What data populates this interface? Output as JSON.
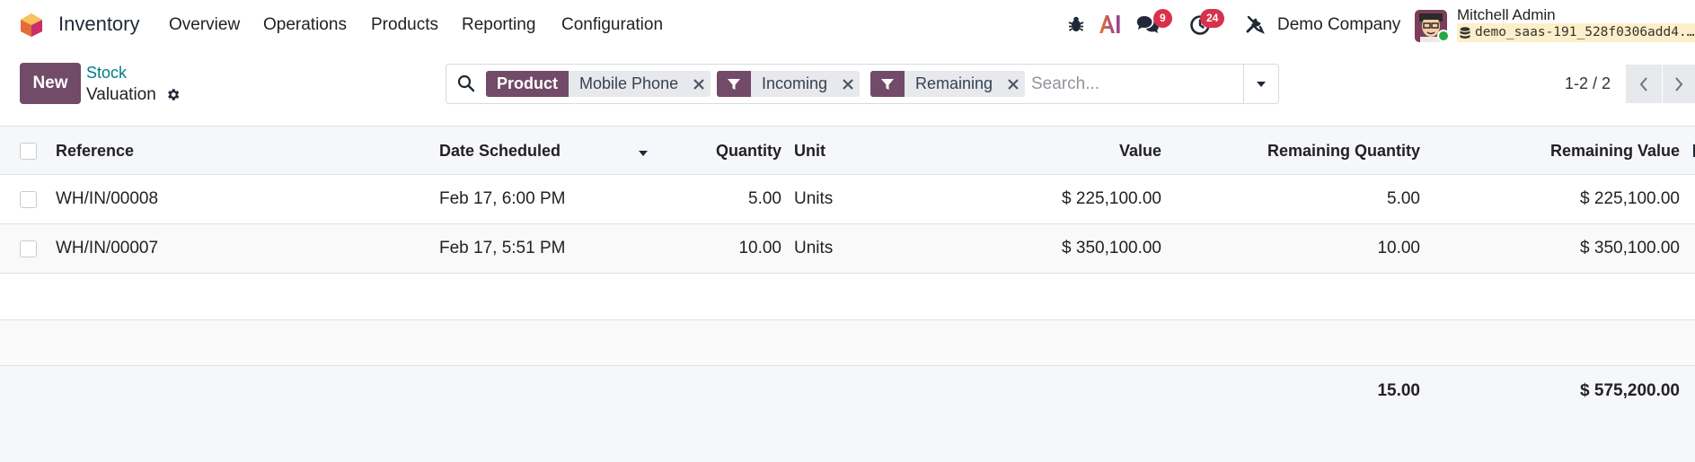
{
  "navbar": {
    "app_name": "Inventory",
    "menu": [
      "Overview",
      "Operations",
      "Products",
      "Reporting",
      "Configuration"
    ],
    "messages_badge": "9",
    "activities_badge": "24",
    "company": "Demo Company",
    "user_name": "Mitchell Admin",
    "database": "demo_saas-191_528f0306add4..."
  },
  "control": {
    "new_label": "New",
    "breadcrumb_parent": "Stock",
    "breadcrumb_current": "Valuation",
    "pager": "1-2 / 2"
  },
  "search": {
    "placeholder": "Search...",
    "facets": [
      {
        "type": "group",
        "label": "Product",
        "value": "Mobile Phone"
      },
      {
        "type": "filter",
        "value": "Incoming"
      },
      {
        "type": "filter",
        "value": "Remaining"
      }
    ]
  },
  "table": {
    "columns": [
      "Reference",
      "Date Scheduled",
      "Quantity",
      "Unit",
      "Value",
      "Remaining Quantity",
      "Remaining Value"
    ],
    "rows": [
      {
        "reference": "WH/IN/00008",
        "date": "Feb 17, 6:00 PM",
        "quantity": "5.00",
        "unit": "Units",
        "value": "$ 225,100.00",
        "remaining_qty": "5.00",
        "remaining_value": "$ 225,100.00"
      },
      {
        "reference": "WH/IN/00007",
        "date": "Feb 17, 5:51 PM",
        "quantity": "10.00",
        "unit": "Units",
        "value": "$ 350,100.00",
        "remaining_qty": "10.00",
        "remaining_value": "$ 350,100.00"
      }
    ],
    "totals": {
      "remaining_qty": "15.00",
      "remaining_value": "$ 575,200.00"
    }
  },
  "colors": {
    "brand": "#714b67",
    "badge": "#d9314b",
    "link": "#017e84",
    "online": "#28a745"
  }
}
